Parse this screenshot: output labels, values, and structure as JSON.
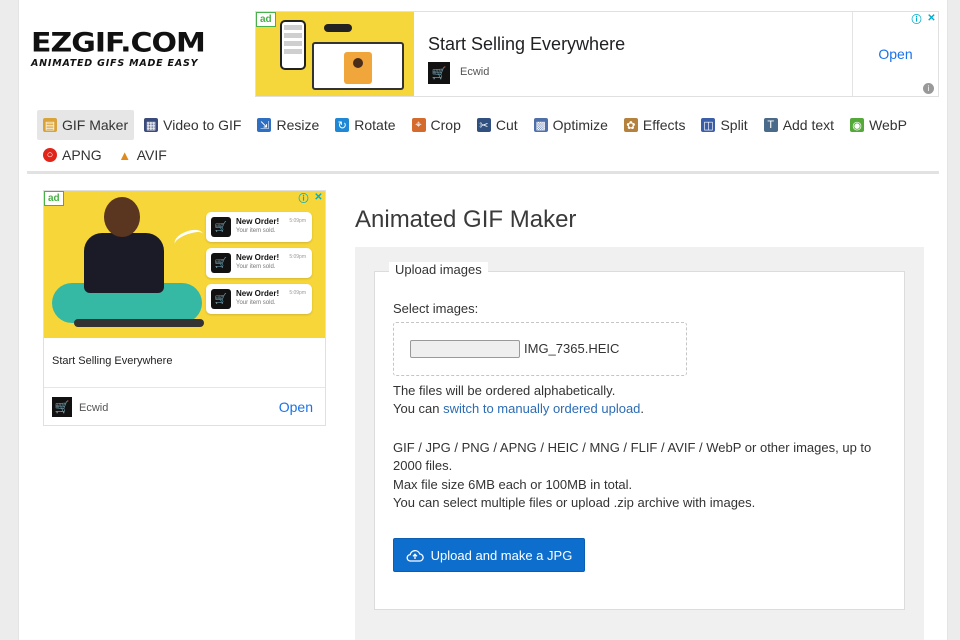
{
  "logo": {
    "main": "EZGIF.COM",
    "tagline": "ANIMATED GIFS MADE EASY"
  },
  "top_ad": {
    "badge": "ad",
    "title": "Start Selling Everywhere",
    "brand": "Ecwid",
    "cta": "Open",
    "info_icon": "info-icon",
    "close_icon": "close-icon"
  },
  "nav": {
    "items": [
      {
        "label": "GIF Maker",
        "icon": "gif-maker-icon",
        "color": "#d9a33a",
        "active": true
      },
      {
        "label": "Video to GIF",
        "icon": "film-icon",
        "color": "#3a4a7a"
      },
      {
        "label": "Resize",
        "icon": "resize-icon",
        "color": "#2f6fc2"
      },
      {
        "label": "Rotate",
        "icon": "rotate-icon",
        "color": "#1e88d6"
      },
      {
        "label": "Crop",
        "icon": "crop-icon",
        "color": "#d46b2c"
      },
      {
        "label": "Cut",
        "icon": "cut-icon",
        "color": "#30507f"
      },
      {
        "label": "Optimize",
        "icon": "optimize-icon",
        "color": "#4f6fa8"
      },
      {
        "label": "Effects",
        "icon": "palette-icon",
        "color": "#b5823e"
      },
      {
        "label": "Split",
        "icon": "split-icon",
        "color": "#3a5ea8"
      },
      {
        "label": "Add text",
        "icon": "add-text-icon",
        "color": "#4a6a8a"
      },
      {
        "label": "WebP",
        "icon": "webp-icon",
        "color": "#55a83a"
      },
      {
        "label": "APNG",
        "icon": "apng-icon",
        "color": "#e1251b"
      },
      {
        "label": "AVIF",
        "icon": "avif-icon",
        "color": "#e08a1e"
      }
    ]
  },
  "side_ad": {
    "badge": "ad",
    "notifications": [
      {
        "title": "New Order!",
        "sub": "Your item sold.",
        "time": "5:09pm"
      },
      {
        "title": "New Order!",
        "sub": "Your item sold.",
        "time": "5:09pm"
      },
      {
        "title": "New Order!",
        "sub": "Your item sold.",
        "time": "5:09pm"
      }
    ],
    "title": "Start Selling Everywhere",
    "brand": "Ecwid",
    "cta": "Open"
  },
  "main": {
    "title": "Animated GIF Maker",
    "legend": "Upload images",
    "select_label": "Select images:",
    "file_name": "IMG_7365.HEIC",
    "order_note": "The files will be ordered alphabetically.",
    "switch_prefix": "You can ",
    "switch_link": "switch to manually ordered upload",
    "switch_suffix": ".",
    "formats_line1": "GIF / JPG / PNG / APNG / HEIC / MNG / FLIF / AVIF / WebP or other images, up to",
    "formats_line2": "2000 files.",
    "max_size": "Max file size 6MB each or 100MB in total.",
    "multi_note": "You can select multiple files or upload .zip archive with images.",
    "upload_button": "Upload and make a JPG"
  }
}
